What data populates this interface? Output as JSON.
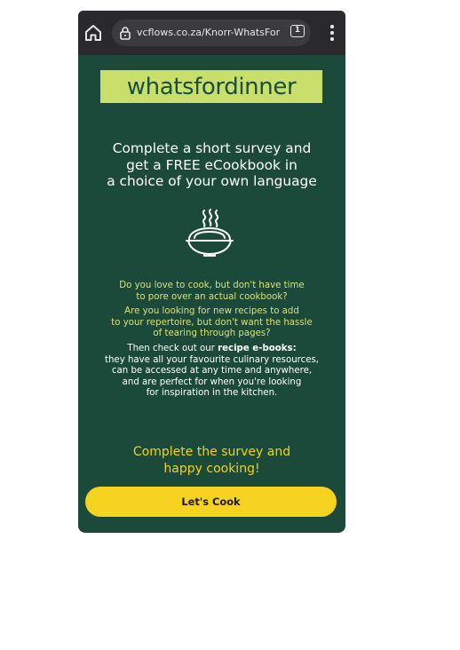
{
  "browser": {
    "url": "vcflows.co.za/Knorr-WhatsFor",
    "tab_count": "1",
    "icons": [
      "home-icon",
      "lock-icon",
      "tabs-icon",
      "more-vert-icon"
    ]
  },
  "page": {
    "brand_logo": "whatsfordinner",
    "headline": [
      "Complete a short survey and",
      "get a FREE eCookbook in",
      "a choice of your own language"
    ],
    "illustration_icon": "noodle-bowl-icon",
    "para1": [
      "Do you love to cook, but don't have time",
      "to pore over an actual cookbook?"
    ],
    "para2": [
      "Are you looking for new recipes to add",
      "to your repertoire, but don't want the hassle",
      "of tearing through pages?"
    ],
    "para3_prefix": "Then check out our ",
    "para3_strong": "recipe e-books:",
    "para3_rest": [
      "they have all your favourite culinary resources,",
      "can be accessed at any time and anywhere,",
      "and are perfect for when you're looking",
      "for inspiration in the kitchen."
    ],
    "cta": [
      "Complete the survey and",
      "happy cooking!"
    ],
    "button_label": "Let's Cook"
  },
  "colors": {
    "background": "#1b4a3b",
    "brand_box": "#c9df6c",
    "accent_yellow": "#f6d320",
    "browser_bar": "#2a2a2c"
  }
}
